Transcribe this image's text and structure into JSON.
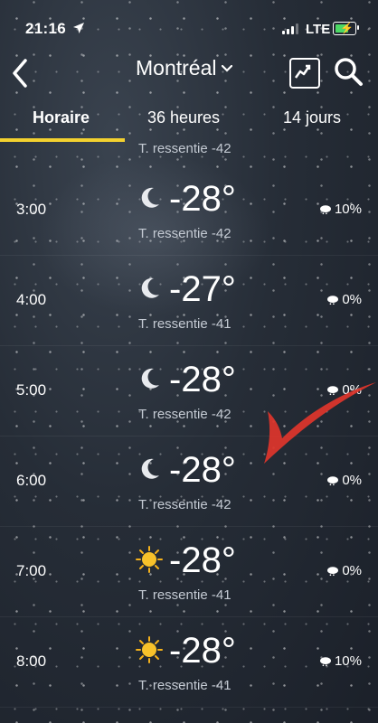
{
  "status_bar": {
    "time": "21:16",
    "network": "LTE"
  },
  "header": {
    "city": "Montréal"
  },
  "tabs": [
    {
      "label": "Horaire",
      "active": true
    },
    {
      "label": "36 heures",
      "active": false
    },
    {
      "label": "14 jours",
      "active": false
    }
  ],
  "top_partial": {
    "feels": "T. ressentie -42"
  },
  "hours": [
    {
      "hour": "3:00",
      "icon": "moon-icon",
      "temp": "-28°",
      "feels": "T. ressentie -42",
      "precip": "10%"
    },
    {
      "hour": "4:00",
      "icon": "moon-icon",
      "temp": "-27°",
      "feels": "T. ressentie -41",
      "precip": "0%"
    },
    {
      "hour": "5:00",
      "icon": "moon-icon",
      "temp": "-28°",
      "feels": "T. ressentie -42",
      "precip": "0%"
    },
    {
      "hour": "6:00",
      "icon": "moon-icon",
      "temp": "-28°",
      "feels": "T. ressentie -42",
      "precip": "0%"
    },
    {
      "hour": "7:00",
      "icon": "sun-icon",
      "temp": "-28°",
      "feels": "T. ressentie -41",
      "precip": "0%"
    },
    {
      "hour": "8:00",
      "icon": "sun-icon",
      "temp": "-28°",
      "feels": "T. ressentie -41",
      "precip": "10%"
    }
  ],
  "colors": {
    "tab_indicator": "#f3d12f",
    "check_annotation": "#e0352b",
    "battery": "#4cd964"
  }
}
